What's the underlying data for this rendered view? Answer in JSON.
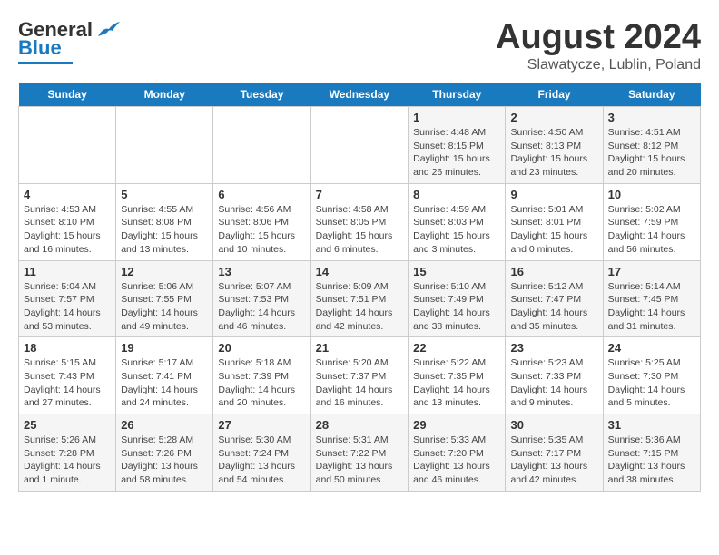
{
  "header": {
    "logo_general": "General",
    "logo_blue": "Blue",
    "month_title": "August 2024",
    "subtitle": "Slawatycze, Lublin, Poland"
  },
  "days_of_week": [
    "Sunday",
    "Monday",
    "Tuesday",
    "Wednesday",
    "Thursday",
    "Friday",
    "Saturday"
  ],
  "weeks": [
    [
      {
        "day": "",
        "info": ""
      },
      {
        "day": "",
        "info": ""
      },
      {
        "day": "",
        "info": ""
      },
      {
        "day": "",
        "info": ""
      },
      {
        "day": "1",
        "info": "Sunrise: 4:48 AM\nSunset: 8:15 PM\nDaylight: 15 hours\nand 26 minutes."
      },
      {
        "day": "2",
        "info": "Sunrise: 4:50 AM\nSunset: 8:13 PM\nDaylight: 15 hours\nand 23 minutes."
      },
      {
        "day": "3",
        "info": "Sunrise: 4:51 AM\nSunset: 8:12 PM\nDaylight: 15 hours\nand 20 minutes."
      }
    ],
    [
      {
        "day": "4",
        "info": "Sunrise: 4:53 AM\nSunset: 8:10 PM\nDaylight: 15 hours\nand 16 minutes."
      },
      {
        "day": "5",
        "info": "Sunrise: 4:55 AM\nSunset: 8:08 PM\nDaylight: 15 hours\nand 13 minutes."
      },
      {
        "day": "6",
        "info": "Sunrise: 4:56 AM\nSunset: 8:06 PM\nDaylight: 15 hours\nand 10 minutes."
      },
      {
        "day": "7",
        "info": "Sunrise: 4:58 AM\nSunset: 8:05 PM\nDaylight: 15 hours\nand 6 minutes."
      },
      {
        "day": "8",
        "info": "Sunrise: 4:59 AM\nSunset: 8:03 PM\nDaylight: 15 hours\nand 3 minutes."
      },
      {
        "day": "9",
        "info": "Sunrise: 5:01 AM\nSunset: 8:01 PM\nDaylight: 15 hours\nand 0 minutes."
      },
      {
        "day": "10",
        "info": "Sunrise: 5:02 AM\nSunset: 7:59 PM\nDaylight: 14 hours\nand 56 minutes."
      }
    ],
    [
      {
        "day": "11",
        "info": "Sunrise: 5:04 AM\nSunset: 7:57 PM\nDaylight: 14 hours\nand 53 minutes."
      },
      {
        "day": "12",
        "info": "Sunrise: 5:06 AM\nSunset: 7:55 PM\nDaylight: 14 hours\nand 49 minutes."
      },
      {
        "day": "13",
        "info": "Sunrise: 5:07 AM\nSunset: 7:53 PM\nDaylight: 14 hours\nand 46 minutes."
      },
      {
        "day": "14",
        "info": "Sunrise: 5:09 AM\nSunset: 7:51 PM\nDaylight: 14 hours\nand 42 minutes."
      },
      {
        "day": "15",
        "info": "Sunrise: 5:10 AM\nSunset: 7:49 PM\nDaylight: 14 hours\nand 38 minutes."
      },
      {
        "day": "16",
        "info": "Sunrise: 5:12 AM\nSunset: 7:47 PM\nDaylight: 14 hours\nand 35 minutes."
      },
      {
        "day": "17",
        "info": "Sunrise: 5:14 AM\nSunset: 7:45 PM\nDaylight: 14 hours\nand 31 minutes."
      }
    ],
    [
      {
        "day": "18",
        "info": "Sunrise: 5:15 AM\nSunset: 7:43 PM\nDaylight: 14 hours\nand 27 minutes."
      },
      {
        "day": "19",
        "info": "Sunrise: 5:17 AM\nSunset: 7:41 PM\nDaylight: 14 hours\nand 24 minutes."
      },
      {
        "day": "20",
        "info": "Sunrise: 5:18 AM\nSunset: 7:39 PM\nDaylight: 14 hours\nand 20 minutes."
      },
      {
        "day": "21",
        "info": "Sunrise: 5:20 AM\nSunset: 7:37 PM\nDaylight: 14 hours\nand 16 minutes."
      },
      {
        "day": "22",
        "info": "Sunrise: 5:22 AM\nSunset: 7:35 PM\nDaylight: 14 hours\nand 13 minutes."
      },
      {
        "day": "23",
        "info": "Sunrise: 5:23 AM\nSunset: 7:33 PM\nDaylight: 14 hours\nand 9 minutes."
      },
      {
        "day": "24",
        "info": "Sunrise: 5:25 AM\nSunset: 7:30 PM\nDaylight: 14 hours\nand 5 minutes."
      }
    ],
    [
      {
        "day": "25",
        "info": "Sunrise: 5:26 AM\nSunset: 7:28 PM\nDaylight: 14 hours\nand 1 minute."
      },
      {
        "day": "26",
        "info": "Sunrise: 5:28 AM\nSunset: 7:26 PM\nDaylight: 13 hours\nand 58 minutes."
      },
      {
        "day": "27",
        "info": "Sunrise: 5:30 AM\nSunset: 7:24 PM\nDaylight: 13 hours\nand 54 minutes."
      },
      {
        "day": "28",
        "info": "Sunrise: 5:31 AM\nSunset: 7:22 PM\nDaylight: 13 hours\nand 50 minutes."
      },
      {
        "day": "29",
        "info": "Sunrise: 5:33 AM\nSunset: 7:20 PM\nDaylight: 13 hours\nand 46 minutes."
      },
      {
        "day": "30",
        "info": "Sunrise: 5:35 AM\nSunset: 7:17 PM\nDaylight: 13 hours\nand 42 minutes."
      },
      {
        "day": "31",
        "info": "Sunrise: 5:36 AM\nSunset: 7:15 PM\nDaylight: 13 hours\nand 38 minutes."
      }
    ]
  ]
}
